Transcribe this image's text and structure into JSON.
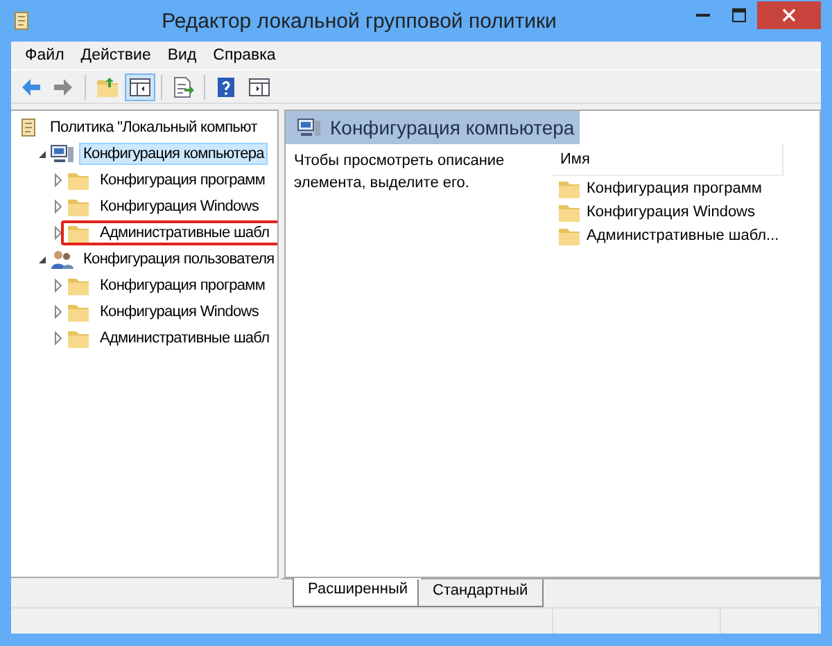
{
  "window": {
    "title": "Редактор локальной групповой политики"
  },
  "menu": [
    {
      "label": "Файл"
    },
    {
      "label": "Действие"
    },
    {
      "label": "Вид"
    },
    {
      "label": "Справка"
    }
  ],
  "toolbar": [
    {
      "kind": "back",
      "pressed": false
    },
    {
      "kind": "forward",
      "pressed": false
    },
    {
      "kind": "sep"
    },
    {
      "kind": "up",
      "pressed": false
    },
    {
      "kind": "tree",
      "pressed": true
    },
    {
      "kind": "sep"
    },
    {
      "kind": "export",
      "pressed": false
    },
    {
      "kind": "sep"
    },
    {
      "kind": "help",
      "pressed": false
    },
    {
      "kind": "pane",
      "pressed": false
    }
  ],
  "tree": [
    {
      "label": "Политика \"Локальный компьют",
      "kind": "policy",
      "children": [
        {
          "label": "Конфигурация компьютера",
          "kind": "computer",
          "expanded": true,
          "selected": true,
          "children": [
            {
              "label": "Конфигурация программ",
              "kind": "folder",
              "expanded": false,
              "selected": false,
              "highlighted": false
            },
            {
              "label": "Конфигурация Windows",
              "kind": "folder",
              "expanded": false,
              "selected": false,
              "highlighted": false
            },
            {
              "label": "Административные шабл",
              "kind": "folder",
              "expanded": false,
              "selected": false,
              "highlighted": true
            }
          ]
        },
        {
          "label": "Конфигурация пользователя",
          "kind": "user",
          "expanded": true,
          "selected": false,
          "children": [
            {
              "label": "Конфигурация программ",
              "kind": "folder",
              "expanded": false,
              "selected": false,
              "highlighted": false
            },
            {
              "label": "Конфигурация Windows",
              "kind": "folder",
              "expanded": false,
              "selected": false,
              "highlighted": false
            },
            {
              "label": "Административные шабл",
              "kind": "folder",
              "expanded": false,
              "selected": false,
              "highlighted": false
            }
          ]
        }
      ]
    }
  ],
  "details": {
    "title": "Конфигурация компьютера",
    "description": "Чтобы просмотреть описание элемента, выделите его.",
    "columns": [
      "Имя"
    ],
    "items": [
      {
        "label": "Конфигурация программ"
      },
      {
        "label": "Конфигурация Windows"
      },
      {
        "label": "Административные шабл..."
      }
    ]
  },
  "tabs": [
    {
      "label": "Расширенный",
      "selected": true
    },
    {
      "label": "Стандартный",
      "selected": false
    }
  ]
}
